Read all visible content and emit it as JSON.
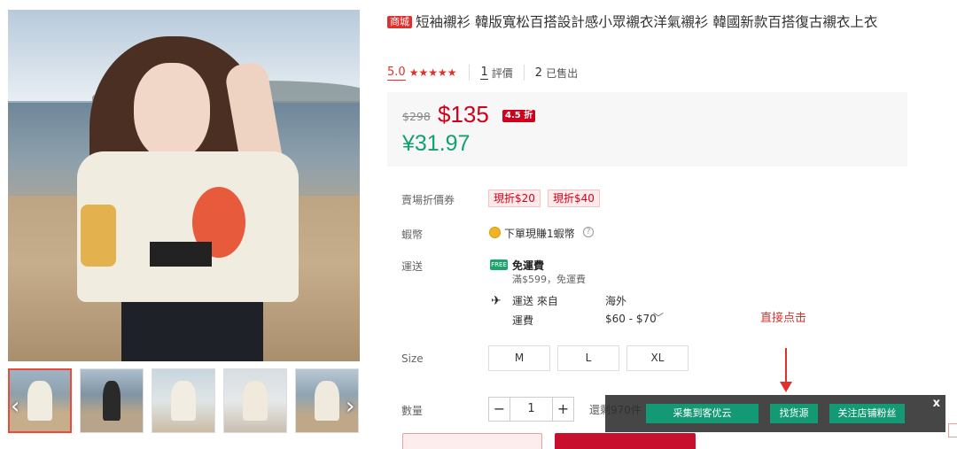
{
  "product": {
    "mall_badge": "商城",
    "title": "短袖襯衫 韓版寬松百搭設計感小眾襯衣洋氣襯衫 韓國新款百搭復古襯衣上衣",
    "rating": "5.0",
    "stars": "★★★★★",
    "review_count": "1",
    "review_label": "評價",
    "sold_count": "2",
    "sold_label": "已售出"
  },
  "price": {
    "original": "$298",
    "current": "$135",
    "discount": "4.5 折",
    "converted": "¥31.97"
  },
  "details": {
    "coupon_label": "賣場折價券",
    "coupons": [
      "現折$20",
      "現折$40"
    ],
    "coin_label": "蝦幣",
    "coin_text": "下單現賺1蝦幣",
    "help_glyph": "?",
    "shipping_label": "運送",
    "free_ship_icon_text": "FREE",
    "free_shipping": "免運費",
    "free_shipping_min": "滿$599，免運費",
    "ship_from_label": "運送 來自",
    "ship_origin": "海外",
    "fee_label": "運費",
    "fee_value": "$60 - $70",
    "fee_chevron": "﹀",
    "size_label": "Size",
    "sizes": [
      "M",
      "L",
      "XL"
    ],
    "qty_label": "數量",
    "qty_minus": "−",
    "qty_value": "1",
    "qty_plus": "+",
    "stock_text": "還剩970件"
  },
  "annotation": {
    "text": "直接点击",
    "color": "#e0302c"
  },
  "overlay": {
    "buttons": [
      "采集到客优云",
      "找货源",
      "关注店铺粉丝"
    ],
    "close": "x"
  },
  "gallery": {
    "prev_arrow": "‹",
    "next_arrow": "›",
    "thumb_count": 5
  },
  "icons": {
    "coin": "coin-icon",
    "help": "help-icon",
    "free_shipping": "free-shipping-icon",
    "plane": "plane-icon",
    "stars": "star-icon"
  },
  "colors": {
    "accent_red": "#d0021b",
    "converted_green": "#15a06f",
    "overlay_btn": "#139a74"
  }
}
